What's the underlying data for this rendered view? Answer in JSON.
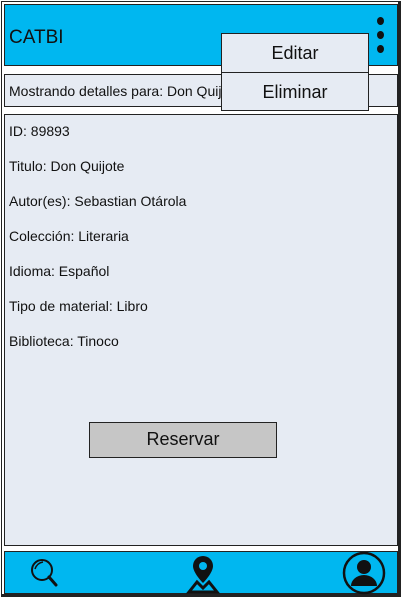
{
  "app": {
    "title": "CATBI"
  },
  "menu": {
    "icon": "kebab-menu-icon",
    "items": [
      {
        "label": "Editar"
      },
      {
        "label": "Eliminar"
      }
    ]
  },
  "details": {
    "header": "Mostrando detalles para: Don Quijote"
  },
  "book": {
    "fields": [
      "ID: 89893",
      "Titulo: Don Quijote",
      "Autor(es): Sebastian Otárola",
      "Colección: Literaria",
      "Idioma: Español",
      "Tipo de material: Libro",
      "Biblioteca: Tinoco"
    ]
  },
  "actions": {
    "reserve_label": "Reservar"
  },
  "bottom_nav": {
    "items": [
      {
        "icon": "search-icon"
      },
      {
        "icon": "map-pin-icon"
      },
      {
        "icon": "user-profile-icon"
      }
    ]
  },
  "colors": {
    "accent": "#00b7f0",
    "panel": "#e6ebf3",
    "button": "#c6c6c6"
  }
}
